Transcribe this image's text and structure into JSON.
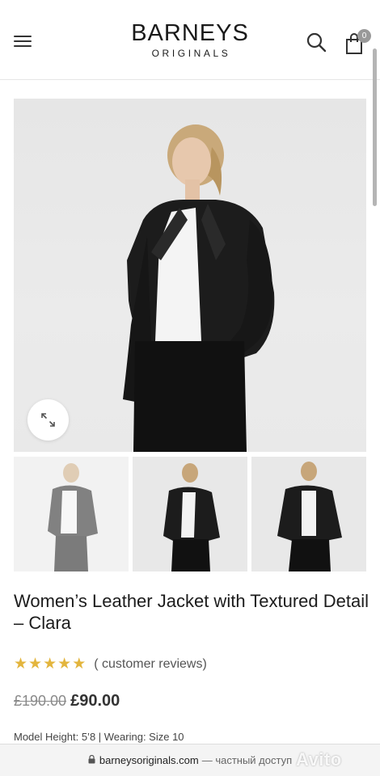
{
  "header": {
    "menu_icon": "hamburger-menu-icon",
    "logo_main": "BARNEYS",
    "logo_sub": "ORIGINALS",
    "search_icon": "search-icon",
    "cart_icon": "shopping-bag-icon",
    "cart_count": "0"
  },
  "gallery": {
    "zoom_icon": "expand-icon",
    "thumbnails_count": 3
  },
  "product": {
    "title": "Women’s Leather Jacket with Textured Detail – Clara",
    "rating_stars": 5,
    "reviews_label": "( customer reviews)",
    "old_price": "£190.00",
    "new_price": "£90.00",
    "model_info": "Model Height: 5’8 | Wearing: Size 10"
  },
  "urlbar": {
    "domain": "barneysoriginals.com",
    "suffix": "— частный доступ",
    "watermark": "Avito"
  },
  "colors": {
    "star": "#e3b53d",
    "badge": "#999999",
    "text": "#1c1c1c"
  }
}
